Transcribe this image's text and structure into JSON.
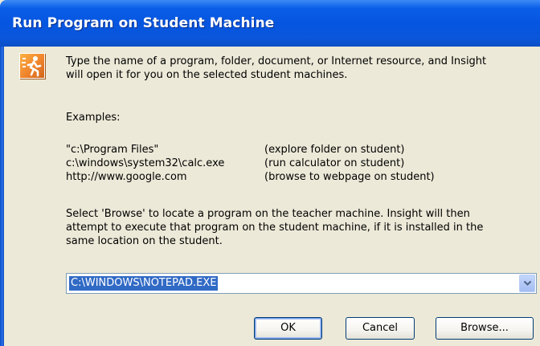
{
  "dialog": {
    "title": "Run Program on Student Machine",
    "description_lines": [
      "Type the name of a program, folder, document, or Internet resource, and Insight",
      "will open it for you on the selected student machines."
    ],
    "examples_heading": "Examples:",
    "examples": [
      {
        "path": "\"c:\\Program Files\"",
        "note": "(explore folder on student)"
      },
      {
        "path": "c:\\windows\\system32\\calc.exe",
        "note": "(run calculator on student)"
      },
      {
        "path": "http://www.google.com",
        "note": "(browse to webpage on student)"
      }
    ],
    "browse_help_lines": [
      "Select 'Browse' to locate a program on the teacher machine. Insight will then",
      "attempt to execute that program on the student machine, if it is installed in the",
      "same location on the student."
    ],
    "command_value": "C:\\WINDOWS\\NOTEPAD.EXE",
    "buttons": {
      "ok": "OK",
      "cancel": "Cancel",
      "browse": "Browse..."
    }
  },
  "icons": {
    "run": "run-icon",
    "dropdown": "chevron-down-icon"
  },
  "colors": {
    "titlebar": "#0655e0",
    "background": "#ece9d8",
    "selection": "#316ac5"
  }
}
